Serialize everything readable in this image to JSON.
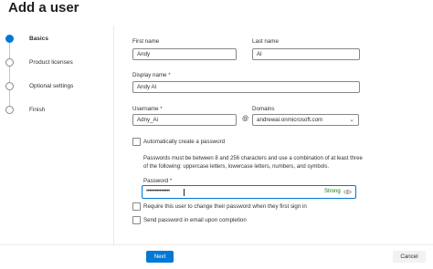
{
  "page": {
    "title": "Add a user"
  },
  "steps": [
    {
      "label": "Basics",
      "active": true
    },
    {
      "label": "Product licenses",
      "active": false
    },
    {
      "label": "Optional settings",
      "active": false
    },
    {
      "label": "Finish",
      "active": false
    }
  ],
  "form": {
    "first_name": {
      "label": "First name",
      "value": "Andy"
    },
    "last_name": {
      "label": "Last name",
      "value": "Al"
    },
    "display_name": {
      "label": "Display name",
      "required_mark": "*",
      "value": "Andy Al"
    },
    "username": {
      "label": "Username",
      "required_mark": "*",
      "value": "Adny_Ai"
    },
    "at_symbol": "@",
    "domains": {
      "label": "Domains",
      "value": "andrewai.onmicrosoft.com"
    },
    "auto_password": {
      "label": "Automatically create a password",
      "checked": false
    },
    "password_info": "Passwords must be between 8 and 256 characters and use a combination of at least three of the following: uppercase letters, lowercase letters, numbers, and symbols.",
    "password": {
      "label": "Password",
      "required_mark": "*",
      "masked_value": "••••••••••••••••",
      "strength": "Strong"
    },
    "require_change": {
      "label": "Require this user to change their password when they first sign in",
      "checked": false
    },
    "send_email": {
      "label": "Send password in email upon completion",
      "checked": false
    }
  },
  "footer": {
    "next_label": "Next",
    "cancel_label": "Cancel"
  },
  "colors": {
    "accent": "#0078d4",
    "strong": "#107c10",
    "required": "#a4262c"
  }
}
